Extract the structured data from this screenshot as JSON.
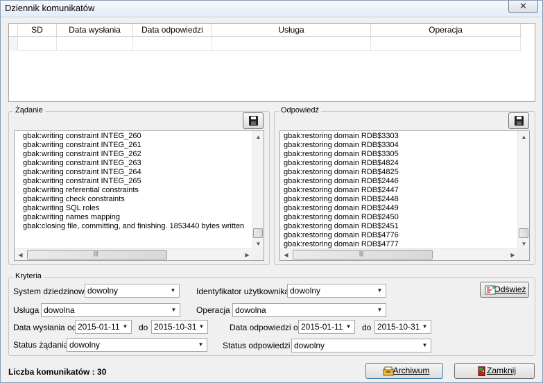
{
  "window": {
    "title": "Dziennik komunikatów",
    "close_glyph": "✕"
  },
  "grid": {
    "columns": [
      "SD",
      "Data wysłania",
      "Data odpowiedzi",
      "Usługa",
      "Operacja"
    ]
  },
  "request": {
    "label": "Żądanie",
    "save_icon": "floppy-disk-icon",
    "lines": [
      "gbak:writing constraint INTEG_260",
      "gbak:writing constraint INTEG_261",
      "gbak:writing constraint INTEG_262",
      "gbak:writing constraint INTEG_263",
      "gbak:writing constraint INTEG_264",
      "gbak:writing constraint INTEG_265",
      "gbak:writing referential constraints",
      "gbak:writing check constraints",
      "gbak:writing SQL roles",
      "gbak:writing names mapping",
      "gbak:closing file, committing, and finishing. 1853440 bytes written"
    ]
  },
  "response": {
    "label": "Odpowiedź",
    "save_icon": "floppy-disk-icon",
    "lines": [
      "gbak:restoring domain RDB$3303",
      "gbak:restoring domain RDB$3304",
      "gbak:restoring domain RDB$3305",
      "gbak:restoring domain RDB$4824",
      "gbak:restoring domain RDB$4825",
      "gbak:restoring domain RDB$2446",
      "gbak:restoring domain RDB$2447",
      "gbak:restoring domain RDB$2448",
      "gbak:restoring domain RDB$2449",
      "gbak:restoring domain RDB$2450",
      "gbak:restoring domain RDB$2451",
      "gbak:restoring domain RDB$4776",
      "gbak:restoring domain RDB$4777"
    ]
  },
  "criteria": {
    "label": "Kryteria",
    "system_label": "System dziedzinowy",
    "system_value": "dowolny",
    "user_id_label": "Identyfikator użytkownika",
    "user_id_value": "dowolny",
    "service_label": "Usługa",
    "service_value": "dowolna",
    "operation_label": "Operacja",
    "operation_value": "dowolna",
    "sent_from_label": "Data wysłania od",
    "sent_from_value": "2015-01-11",
    "sent_to_label": "do",
    "sent_to_value": "2015-10-31",
    "resp_from_label": "Data odpowiedzi od",
    "resp_from_value": "2015-01-11",
    "resp_to_label": "do",
    "resp_to_value": "2015-10-31",
    "req_status_label": "Status żądania",
    "req_status_value": "dowolny",
    "resp_status_label": "Status odpowiedzi",
    "resp_status_value": "dowolny",
    "refresh_label": "Odśwież"
  },
  "footer": {
    "count_text": "Liczba komunikatów : 30",
    "archive_label": "Archiwum",
    "close_label": "Zamknij"
  },
  "colors": {
    "window_bg": "#f0f0f0",
    "border": "#a0a0a0"
  }
}
